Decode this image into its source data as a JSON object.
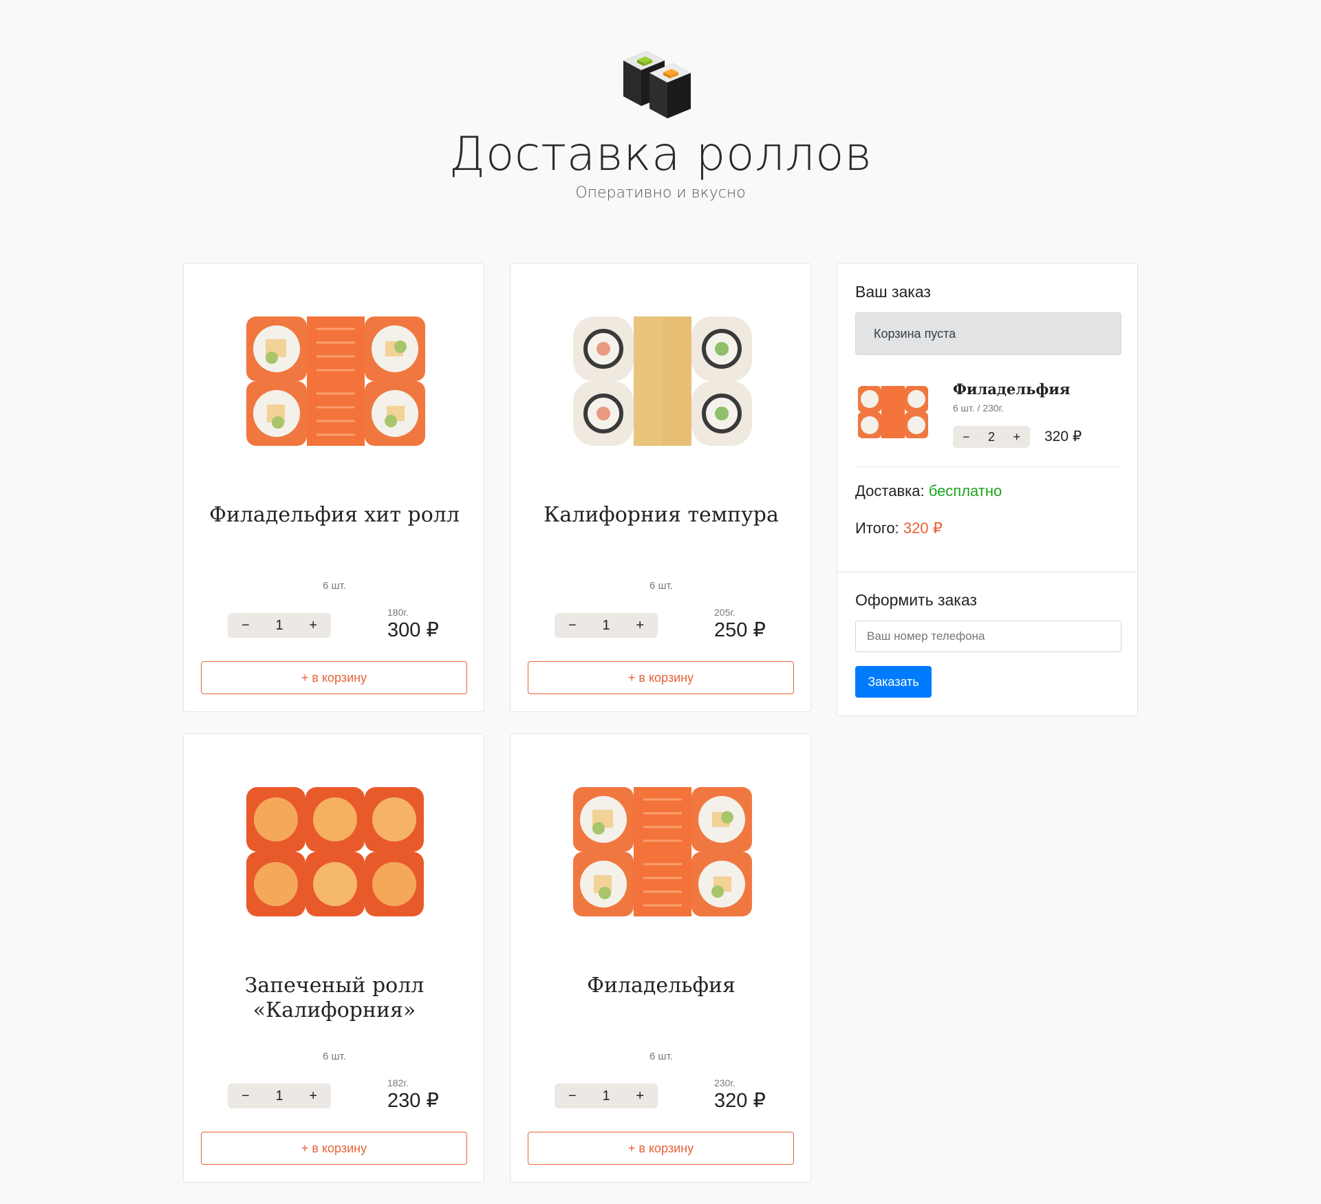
{
  "header": {
    "title": "Доставка роллов",
    "subtitle": "Оперативно и вкусно",
    "logo_icon": "sushi-rolls-logo"
  },
  "products": [
    {
      "name": "Филадельфия хит ролл",
      "pieces": "6 шт.",
      "qty": "1",
      "weight": "180г.",
      "price": "300 ₽",
      "add_label": "+ в корзину",
      "image": "philadelphia-roll"
    },
    {
      "name": "Калифорния темпура",
      "pieces": "6 шт.",
      "qty": "1",
      "weight": "205г.",
      "price": "250 ₽",
      "add_label": "+ в корзину",
      "image": "california-tempura"
    },
    {
      "name": "Запеченый ролл «Калифорния»",
      "pieces": "6 шт.",
      "qty": "1",
      "weight": "182г.",
      "price": "230 ₽",
      "add_label": "+ в корзину",
      "image": "baked-california"
    },
    {
      "name": "Филадельфия",
      "pieces": "6 шт.",
      "qty": "1",
      "weight": "230г.",
      "price": "320 ₽",
      "add_label": "+ в корзину",
      "image": "philadelphia-roll"
    }
  ],
  "stepper": {
    "minus": "−",
    "plus": "+"
  },
  "order": {
    "title": "Ваш заказ",
    "empty_text": "Корзина пуста",
    "item": {
      "name": "Филадельфия",
      "sub": "6 шт. / 230г.",
      "qty": "2",
      "price": "320 ₽"
    },
    "delivery_label": "Доставка:",
    "delivery_value": "бесплатно",
    "total_label": "Итого:",
    "total_value": "320 ₽",
    "checkout_title": "Оформить заказ",
    "phone_placeholder": "Ваш номер телефона",
    "submit_label": "Заказать"
  },
  "colors": {
    "accent": "#e8623a",
    "primary": "#007bff",
    "green": "#1aa51a"
  }
}
